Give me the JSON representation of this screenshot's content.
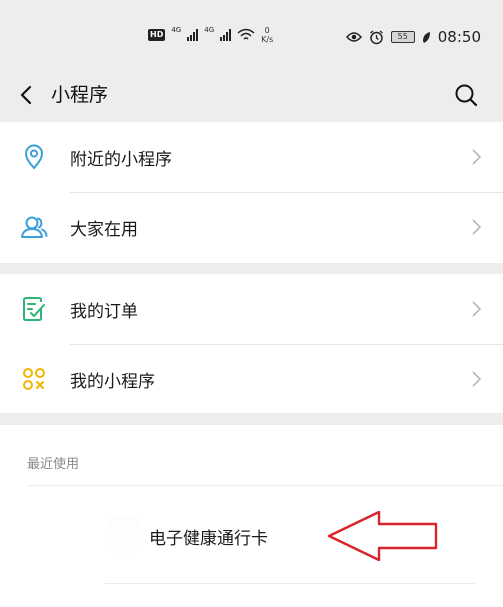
{
  "status_bar": {
    "hd_badge": "HD",
    "net_tag_1": "4G",
    "net_tag_2": "4G",
    "speed_value": "0",
    "speed_unit": "K/s",
    "battery_level": "55",
    "time": "08:50"
  },
  "nav": {
    "title": "小程序"
  },
  "menu_group_1": [
    {
      "label": "附近的小程序",
      "icon": "location-pin-icon",
      "icon_color": "#3b9fdc"
    },
    {
      "label": "大家在用",
      "icon": "people-icon",
      "icon_color": "#3b9fdc"
    }
  ],
  "menu_group_2": [
    {
      "label": "我的订单",
      "icon": "order-list-icon",
      "icon_color": "#2bb673"
    },
    {
      "label": "我的小程序",
      "icon": "mini-programs-icon",
      "icon_color": "#f2b500"
    }
  ],
  "recent": {
    "header": "最近使用",
    "items": [
      {
        "label": "电子健康通行卡"
      }
    ]
  },
  "colors": {
    "background": "#ededed",
    "card": "#ffffff",
    "annotation_arrow": "#d9232d"
  }
}
